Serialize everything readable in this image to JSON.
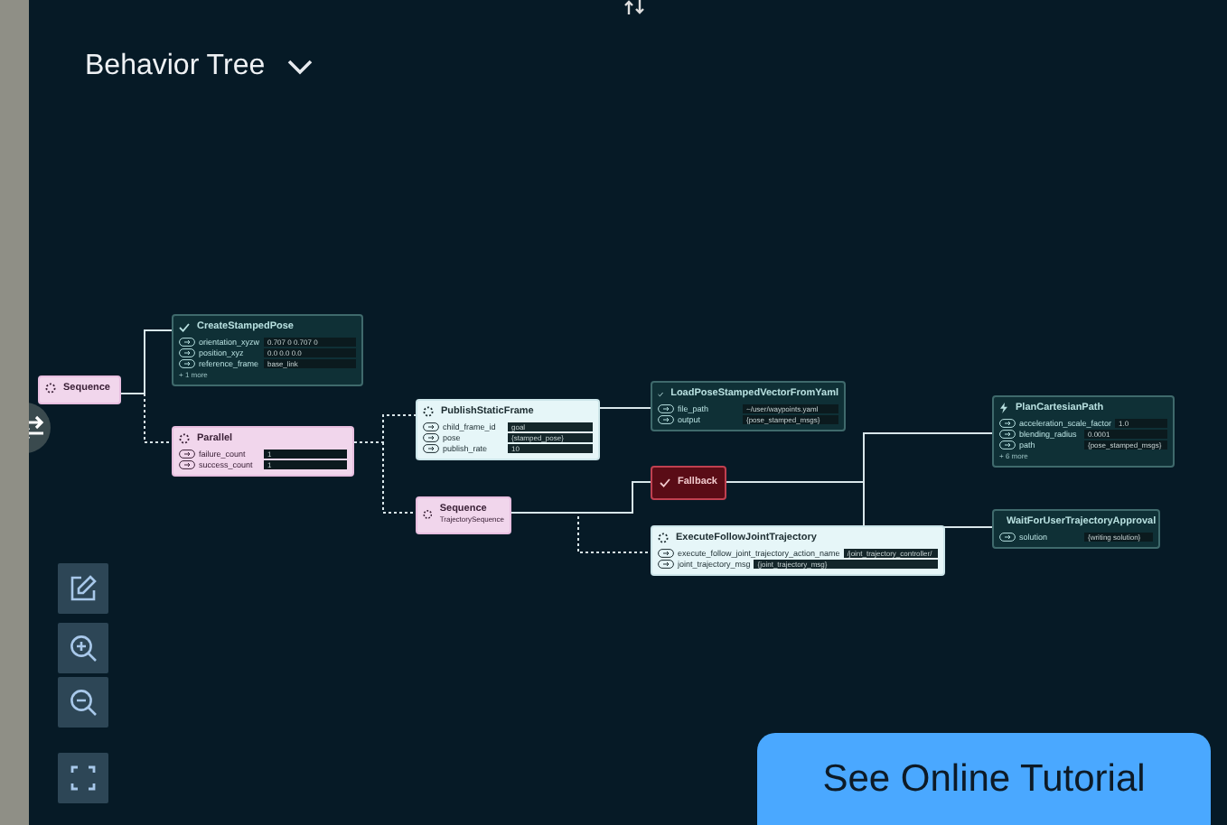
{
  "header": {
    "title": "Behavior Tree"
  },
  "nodes": [
    {
      "kind": "control",
      "title": "Sequence"
    },
    {
      "kind": "done",
      "title": "CreateStampedPose",
      "ports": [
        {
          "name": "orientation_xyzw",
          "value": "0.707 0 0.707 0"
        },
        {
          "name": "position_xyz",
          "value": "0.0 0.0 0.0"
        },
        {
          "name": "reference_frame",
          "value": "base_link"
        }
      ],
      "more": "+ 1 more"
    },
    {
      "kind": "control",
      "title": "Parallel",
      "ports": [
        {
          "name": "failure_count",
          "value": "1"
        },
        {
          "name": "success_count",
          "value": "1"
        }
      ]
    },
    {
      "kind": "running",
      "title": "PublishStaticFrame",
      "ports": [
        {
          "name": "child_frame_id",
          "value": "goal"
        },
        {
          "name": "pose",
          "value": "{stamped_pose}"
        },
        {
          "name": "publish_rate",
          "value": "10"
        }
      ]
    },
    {
      "kind": "control",
      "title": "Sequence",
      "subtitle": "TrajectorySequence"
    },
    {
      "kind": "done",
      "title": "LoadPoseStampedVectorFromYaml",
      "ports": [
        {
          "name": "file_path",
          "value": "~/user/waypoints.yaml"
        },
        {
          "name": "output",
          "value": "{pose_stamped_msgs}"
        }
      ]
    },
    {
      "kind": "failed",
      "title": "Fallback"
    },
    {
      "kind": "running",
      "title": "ExecuteFollowJointTrajectory",
      "ports": [
        {
          "name": "execute_follow_joint_trajectory_action_name",
          "value": "/joint_trajectory_controller/"
        },
        {
          "name": "joint_trajectory_msg",
          "value": "{joint_trajectory_msg}"
        }
      ]
    },
    {
      "kind": "pending",
      "title": "PlanCartesianPath",
      "ports": [
        {
          "name": "acceleration_scale_factor",
          "value": "1.0"
        },
        {
          "name": "blending_radius",
          "value": "0.0001"
        },
        {
          "name": "path",
          "value": "{pose_stamped_msgs}"
        }
      ],
      "more": "+ 6 more"
    },
    {
      "kind": "pending",
      "title": "WaitForUserTrajectoryApproval",
      "ports": [
        {
          "name": "solution",
          "value": "{writing solution}"
        }
      ]
    }
  ],
  "tools": [
    {
      "kind": "edit"
    },
    {
      "kind": "zoom-in"
    },
    {
      "kind": "zoom-out"
    },
    {
      "kind": "fit"
    }
  ],
  "tutorial_button": "See Online Tutorial"
}
